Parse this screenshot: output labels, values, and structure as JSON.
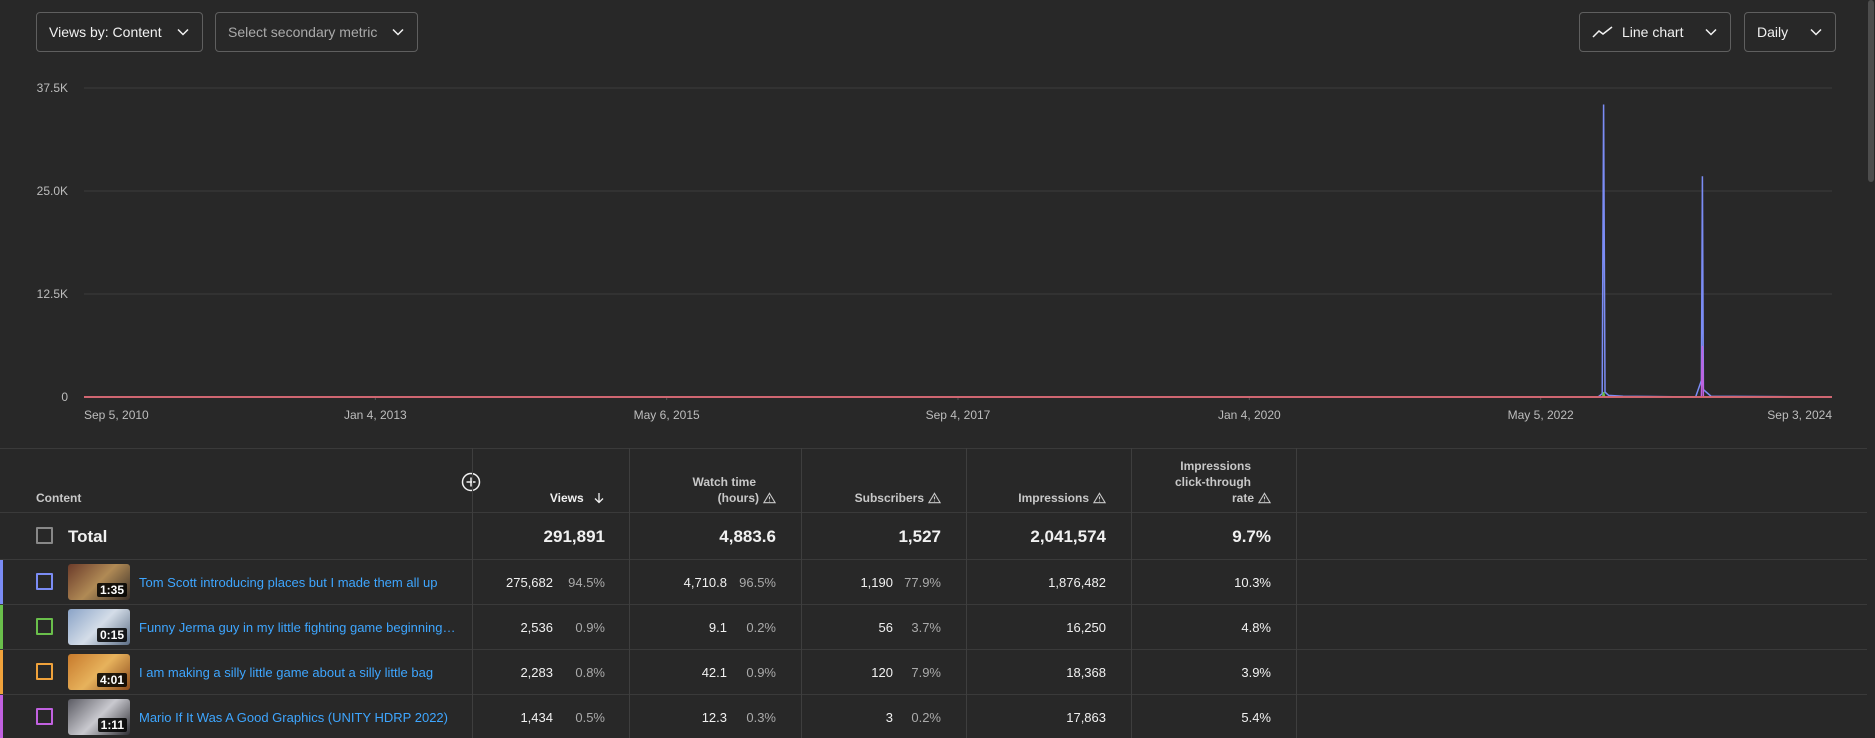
{
  "controls": {
    "views_by": "Views by: Content",
    "secondary_metric_placeholder": "Select secondary metric",
    "chart_type": "Line chart",
    "granularity": "Daily"
  },
  "chart_data": {
    "type": "line",
    "x_tick_labels": [
      "Sep 5, 2010",
      "Jan 4, 2013",
      "May 6, 2015",
      "Sep 4, 2017",
      "Jan 4, 2020",
      "May 5, 2022",
      "Sep 3, 2024"
    ],
    "y_tick_labels": [
      "37.5K",
      "25.0K",
      "12.5K",
      "0"
    ],
    "ylim": [
      0,
      37500
    ],
    "xlim": [
      "2010-09-05",
      "2024-09-03"
    ],
    "grid": true,
    "series": [
      {
        "color": "#7b8cf5",
        "points": [
          [
            "2010-09-05",
            0
          ],
          [
            "2022-10-20",
            0
          ],
          [
            "2022-11-01",
            400
          ],
          [
            "2022-11-05",
            35500
          ],
          [
            "2022-11-09",
            600
          ],
          [
            "2022-11-20",
            200
          ],
          [
            "2023-01-01",
            100
          ],
          [
            "2023-08-01",
            0
          ],
          [
            "2023-08-18",
            2000
          ],
          [
            "2023-08-21",
            26800
          ],
          [
            "2023-08-24",
            900
          ],
          [
            "2023-09-15",
            100
          ],
          [
            "2024-09-03",
            0
          ]
        ]
      },
      {
        "color": "#6abf4b",
        "points": [
          [
            "2010-09-05",
            0
          ],
          [
            "2022-11-02",
            0
          ],
          [
            "2022-11-05",
            600
          ],
          [
            "2022-11-08",
            0
          ],
          [
            "2024-09-03",
            0
          ]
        ]
      },
      {
        "color": "#f0a23b",
        "points": [
          [
            "2010-09-05",
            0
          ],
          [
            "2024-09-03",
            0
          ]
        ]
      },
      {
        "color": "#c161e0",
        "points": [
          [
            "2010-09-05",
            0
          ],
          [
            "2023-08-18",
            0
          ],
          [
            "2023-08-21",
            6200
          ],
          [
            "2023-08-24",
            0
          ],
          [
            "2024-09-03",
            0
          ]
        ]
      }
    ]
  },
  "table": {
    "headers": {
      "content": "Content",
      "views": "Views",
      "watch_time_l1": "Watch time",
      "watch_time_l2": "(hours)",
      "subscribers": "Subscribers",
      "impressions": "Impressions",
      "ctr_l1": "Impressions",
      "ctr_l2": "click-through",
      "ctr_l3": "rate"
    },
    "total": {
      "label": "Total",
      "views": "291,891",
      "watch_time": "4,883.6",
      "subscribers": "1,527",
      "impressions": "2,041,574",
      "ctr": "9.7%"
    },
    "rows": [
      {
        "color": "#7b8cf5",
        "duration": "1:35",
        "title": "Tom Scott introducing places but I made them all up",
        "views": "275,682",
        "views_pct": "94.5%",
        "watch": "4,710.8",
        "watch_pct": "96.5%",
        "subs": "1,190",
        "subs_pct": "77.9%",
        "impressions": "1,876,482",
        "ctr": "10.3%"
      },
      {
        "color": "#6abf4b",
        "duration": "0:15",
        "title": "Funny Jerma guy in my little fighting game beginnings ...",
        "views": "2,536",
        "views_pct": "0.9%",
        "watch": "9.1",
        "watch_pct": "0.2%",
        "subs": "56",
        "subs_pct": "3.7%",
        "impressions": "16,250",
        "ctr": "4.8%"
      },
      {
        "color": "#f0a23b",
        "duration": "4:01",
        "title": "I am making a silly little game about a silly little bag",
        "views": "2,283",
        "views_pct": "0.8%",
        "watch": "42.1",
        "watch_pct": "0.9%",
        "subs": "120",
        "subs_pct": "7.9%",
        "impressions": "18,368",
        "ctr": "3.9%"
      },
      {
        "color": "#c161e0",
        "duration": "1:11",
        "title": "Mario If It Was A Good Graphics (UNITY HDRP 2022)",
        "views": "1,434",
        "views_pct": "0.5%",
        "watch": "12.3",
        "watch_pct": "0.3%",
        "subs": "3",
        "subs_pct": "0.2%",
        "impressions": "17,863",
        "ctr": "5.4%"
      }
    ]
  }
}
